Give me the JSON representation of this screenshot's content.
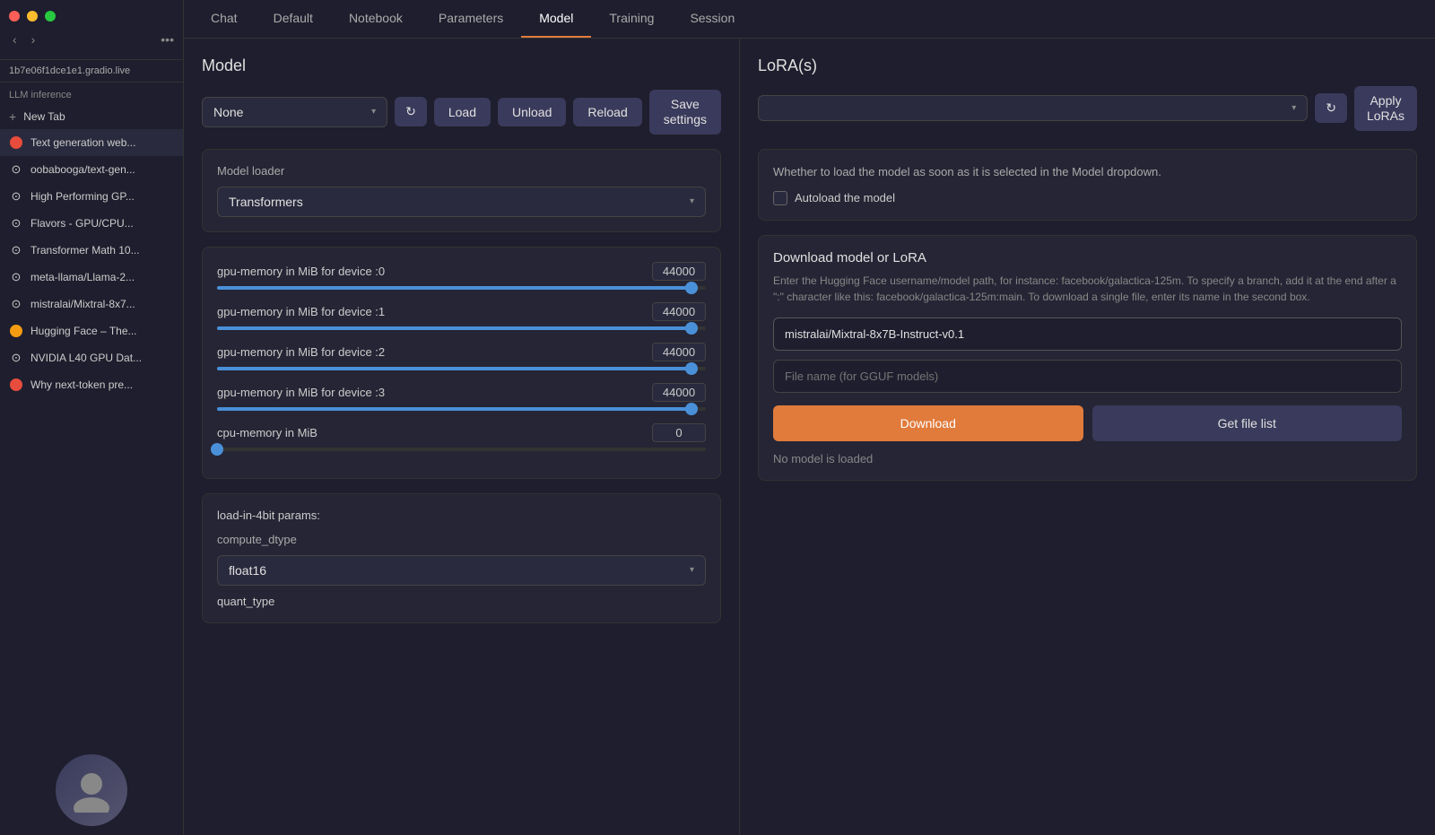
{
  "window": {
    "title": "LLM inference"
  },
  "sidebar": {
    "url": "1b7e06f1dce1e1.gradio.live",
    "label": "LLM inference",
    "new_tab": "New Tab",
    "items": [
      {
        "id": "text-gen",
        "text": "Text generation web...",
        "icon": "circle",
        "badge": "red"
      },
      {
        "id": "oobabooga",
        "text": "oobabooga/text-gen...",
        "icon": "github"
      },
      {
        "id": "high-perf",
        "text": "High Performing GP...",
        "icon": "github"
      },
      {
        "id": "flavors",
        "text": "Flavors - GPU/CPU...",
        "icon": "github"
      },
      {
        "id": "transformer-math",
        "text": "Transformer Math 10...",
        "icon": "github"
      },
      {
        "id": "meta-llama",
        "text": "meta-llama/Llama-2...",
        "icon": "github"
      },
      {
        "id": "mistralai",
        "text": "mistralai/Mixtral-8x7...",
        "icon": "github"
      },
      {
        "id": "hugging-face",
        "text": "Hugging Face – The...",
        "icon": "circle",
        "badge": "yellow"
      },
      {
        "id": "nvidia",
        "text": "NVIDIA L40 GPU Dat...",
        "icon": "github"
      },
      {
        "id": "why-next",
        "text": "Why next-token pre...",
        "icon": "circle",
        "badge": "red"
      }
    ]
  },
  "nav": {
    "tabs": [
      {
        "id": "chat",
        "label": "Chat"
      },
      {
        "id": "default",
        "label": "Default"
      },
      {
        "id": "notebook",
        "label": "Notebook"
      },
      {
        "id": "parameters",
        "label": "Parameters"
      },
      {
        "id": "model",
        "label": "Model",
        "active": true
      },
      {
        "id": "training",
        "label": "Training"
      },
      {
        "id": "session",
        "label": "Session"
      }
    ]
  },
  "left_panel": {
    "title": "Model",
    "model_select": {
      "value": "None",
      "placeholder": "None"
    },
    "buttons": {
      "refresh": "↻",
      "load": "Load",
      "unload": "Unload",
      "reload": "Reload",
      "save_settings": "Save\nsettings"
    },
    "model_loader": {
      "title": "Model loader",
      "value": "Transformers"
    },
    "sliders": [
      {
        "id": "gpu0",
        "label": "gpu-memory in MiB for device :0",
        "value": "44000",
        "percent": 97
      },
      {
        "id": "gpu1",
        "label": "gpu-memory in MiB for device :1",
        "value": "44000",
        "percent": 97
      },
      {
        "id": "gpu2",
        "label": "gpu-memory in MiB for device :2",
        "value": "44000",
        "percent": 97
      },
      {
        "id": "gpu3",
        "label": "gpu-memory in MiB for device :3",
        "value": "44000",
        "percent": 97
      },
      {
        "id": "cpu",
        "label": "cpu-memory in MiB",
        "value": "0",
        "percent": 0
      }
    ],
    "load_in_4bit": {
      "title": "load-in-4bit params:",
      "compute_dtype": {
        "label": "compute_dtype",
        "value": "float16"
      },
      "quant_type": {
        "label": "quant_type"
      }
    }
  },
  "right_panel": {
    "lora": {
      "title": "LoRA(s)",
      "select_placeholder": "",
      "apply_label": "Apply\nLoRAs"
    },
    "autoload": {
      "description": "Whether to load the model as soon as it is selected in the Model dropdown.",
      "checkbox_label": "Autoload the model"
    },
    "download": {
      "title": "Download model or LoRA",
      "description": "Enter the Hugging Face username/model path, for instance: facebook/galactica-125m. To specify a branch, add it at the end after a \":\" character like this: facebook/galactica-125m:main. To download a single file, enter its name in the second box.",
      "model_input_value": "mistralai/Mixtral-8x7B-Instruct-v0.1",
      "file_placeholder": "File name (for GGUF models)",
      "download_btn": "Download",
      "file_list_btn": "Get file list",
      "status": "No model is loaded"
    }
  }
}
